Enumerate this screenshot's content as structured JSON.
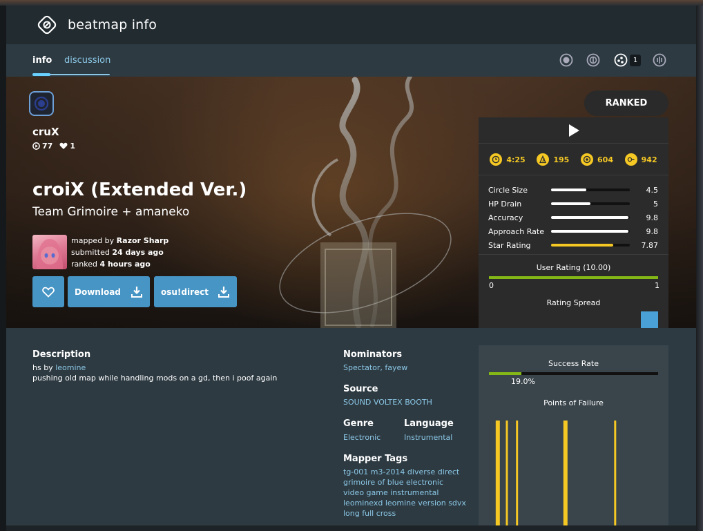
{
  "header": {
    "title": "beatmap info",
    "logo_icon": "beatmap-logo-icon"
  },
  "tabs": {
    "info": "info",
    "discussion": "discussion"
  },
  "modes": {
    "taiko_count": "1"
  },
  "hero": {
    "difficulty_name": "cruX",
    "play_count": "77",
    "favourite_count": "1",
    "title": "croiX (Extended Ver.)",
    "artist": "Team Grimoire + amaneko",
    "mapped_by_prefix": "mapped by",
    "mapper": "Razor Sharp",
    "submitted_prefix": "submitted",
    "submitted": "24 days ago",
    "ranked_prefix": "ranked",
    "ranked": "4 hours ago",
    "download_label": "Download",
    "direct_label": "osu!direct",
    "status": "RANKED"
  },
  "stats": {
    "length": "4:25",
    "bpm": "195",
    "circles": "604",
    "sliders": "942",
    "attributes": [
      {
        "label": "Circle Size",
        "value": "4.5",
        "fraction": 0.45,
        "color": "#ffffff"
      },
      {
        "label": "HP Drain",
        "value": "5",
        "fraction": 0.5,
        "color": "#ffffff"
      },
      {
        "label": "Accuracy",
        "value": "9.8",
        "fraction": 0.98,
        "color": "#ffffff"
      },
      {
        "label": "Approach Rate",
        "value": "9.8",
        "fraction": 0.98,
        "color": "#ffffff"
      },
      {
        "label": "Star Rating",
        "value": "7.87",
        "fraction": 0.787,
        "color": "#f5c824"
      }
    ],
    "user_rating_title": "User Rating (10.00)",
    "user_rating_min": "0",
    "user_rating_max": "1",
    "rating_spread_title": "Rating Spread"
  },
  "info": {
    "description_label": "Description",
    "description_prefix": "hs by",
    "description_link": "leomine",
    "description_text": "pushing old map while handling mods on a gd, then i poof again",
    "nominators_label": "Nominators",
    "nominator_1": "Spectator",
    "nominator_sep": ",",
    "nominator_2": "fayew",
    "source_label": "Source",
    "source": "SOUND VOLTEX BOOTH",
    "genre_label": "Genre",
    "genre": "Electronic",
    "language_label": "Language",
    "language": "Instrumental",
    "tags_label": "Mapper Tags",
    "tags": [
      "tg-001 m3-2014 diverse direct",
      "grimoire of blue electronic",
      "video game instrumental",
      "leominexd leomine version sdvx",
      "long full cross"
    ]
  },
  "success": {
    "title": "Success Rate",
    "rate_text": "19.0%",
    "rate": 0.19,
    "points_title": "Points of Failure",
    "failure_points": [
      {
        "position": 0.04,
        "height": 1.0
      },
      {
        "position": 0.1,
        "height": 1.0
      },
      {
        "position": 0.16,
        "height": 1.0
      },
      {
        "position": 0.44,
        "height": 1.0
      },
      {
        "position": 0.74,
        "height": 1.0
      }
    ]
  },
  "colors": {
    "accent": "#4795c5",
    "link": "#8cc8e6",
    "star": "#f5c824",
    "rating_green": "#84b816"
  }
}
